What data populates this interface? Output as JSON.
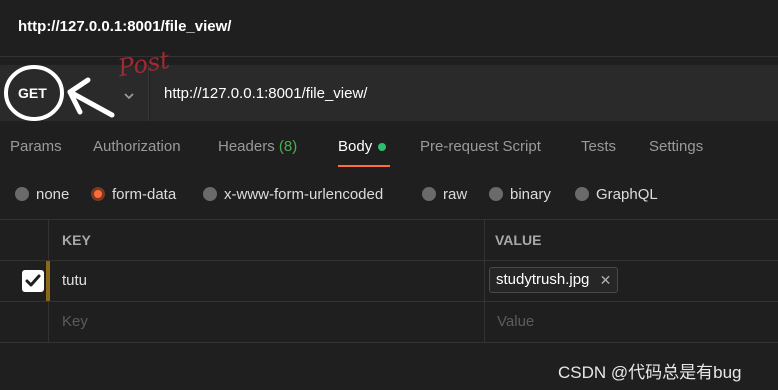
{
  "window": {
    "title": "http://127.0.0.1:8001/file_view/"
  },
  "request": {
    "method": "GET",
    "url": "http://127.0.0.1:8001/file_view/",
    "annotation": "Post"
  },
  "tabs": [
    {
      "label": "Params"
    },
    {
      "label": "Authorization"
    },
    {
      "label": "Headers",
      "count": "(8)"
    },
    {
      "label": "Body",
      "active": true
    },
    {
      "label": "Pre-request Script"
    },
    {
      "label": "Tests"
    },
    {
      "label": "Settings"
    }
  ],
  "body_types": [
    {
      "label": "none",
      "selected": false
    },
    {
      "label": "form-data",
      "selected": true
    },
    {
      "label": "x-www-form-urlencoded",
      "selected": false
    },
    {
      "label": "raw",
      "selected": false
    },
    {
      "label": "binary",
      "selected": false
    },
    {
      "label": "GraphQL",
      "selected": false
    }
  ],
  "table": {
    "headers": {
      "key": "KEY",
      "value": "VALUE"
    },
    "rows": [
      {
        "key": "tutu",
        "value": "studytrush.jpg",
        "checked": true
      }
    ],
    "placeholders": {
      "key": "Key",
      "value": "Value"
    }
  },
  "watermark": "CSDN @代码总是有bug",
  "colors": {
    "accent": "#ff6c37",
    "body_dot": "#2ebf6c",
    "headers_count": "#4caf50",
    "annotation": "#a02a32"
  }
}
